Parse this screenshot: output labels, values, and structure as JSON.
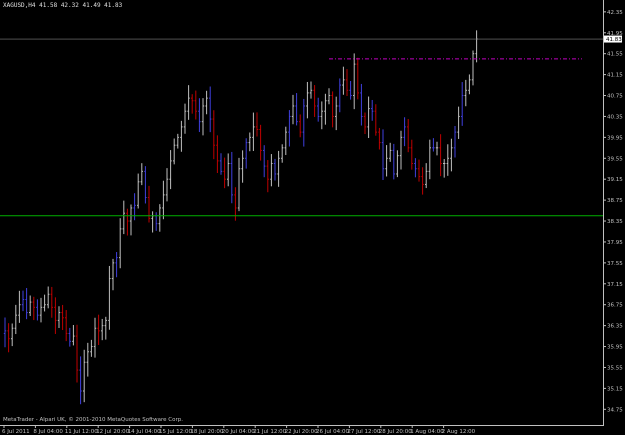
{
  "header": {
    "symbol": "XAGUSD,H4",
    "ohlc": "41.58 42.32 41.49 41.83"
  },
  "copyright": "MetaTrader - Alpari UK, © 2001-2010 MetaQuotes Software Corp.",
  "current_price_label": "41.83",
  "colors": {
    "background": "#000000",
    "up_bar": "#c0c0c0",
    "down_bar_red": "#c00000",
    "down_bar_blue": "#4040e0",
    "green_level": "#00b000",
    "magenta_level": "#c000c0",
    "axis_text": "#c0c0c0"
  },
  "chart_data": {
    "type": "ohlc",
    "title": "XAGUSD,H4",
    "ylim": [
      34.45,
      42.5
    ],
    "y_ticks": [
      "42.35",
      "41.95",
      "41.55",
      "41.15",
      "40.75",
      "40.35",
      "39.95",
      "39.55",
      "39.15",
      "38.75",
      "38.35",
      "37.95",
      "37.55",
      "37.15",
      "36.75",
      "36.35",
      "35.95",
      "35.55",
      "35.15",
      "34.75"
    ],
    "x_tick_labels": [
      "6 Jul 2011",
      "8 Jul 04:00",
      "11 Jul 12:00",
      "12 Jul 20:00",
      "14 Jul 04:00",
      "15 Jul 12:00",
      "18 Jul 20:00",
      "20 Jul 04:00",
      "21 Jul 12:00",
      "22 Jul 20:00",
      "26 Jul 04:00",
      "27 Jul 12:00",
      "28 Jul 20:00",
      "1 Aug 04:00",
      "2 Aug 12:00"
    ],
    "horizontal_levels": [
      {
        "price": 38.45,
        "style": "solid",
        "color": "#00b000"
      },
      {
        "price": 41.45,
        "style": "dashdot",
        "color": "#c000c0",
        "from_bar": 90
      }
    ],
    "closes": [
      36.25,
      36.1,
      36.3,
      36.55,
      36.75,
      36.85,
      36.6,
      36.8,
      36.7,
      36.55,
      36.7,
      36.75,
      36.95,
      36.7,
      36.45,
      36.6,
      36.5,
      36.2,
      36.05,
      36.15,
      35.5,
      35.1,
      35.65,
      35.85,
      35.95,
      36.3,
      36.25,
      36.35,
      36.45,
      37.25,
      37.55,
      37.65,
      38.2,
      38.5,
      38.35,
      38.6,
      38.65,
      39.1,
      39.3,
      38.8,
      38.4,
      38.45,
      38.3,
      38.6,
      38.85,
      39.15,
      39.5,
      39.8,
      39.95,
      40.15,
      40.45,
      40.7,
      40.65,
      40.45,
      40.25,
      40.55,
      40.7,
      40.3,
      39.8,
      39.5,
      39.3,
      39.15,
      39.45,
      38.85,
      38.6,
      39.35,
      39.55,
      39.85,
      39.95,
      40.15,
      40.1,
      39.7,
      39.4,
      39.15,
      39.45,
      39.25,
      39.55,
      39.75,
      40.05,
      40.35,
      40.55,
      40.25,
      40.05,
      40.55,
      40.8,
      40.85,
      40.55,
      40.35,
      40.45,
      40.65,
      40.75,
      40.35,
      40.55,
      40.95,
      41.05,
      40.85,
      40.75,
      41.35,
      40.8,
      40.35,
      40.15,
      40.5,
      40.45,
      40.05,
      39.85,
      39.35,
      39.55,
      39.7,
      39.25,
      39.6,
      39.95,
      40.15,
      39.75,
      39.45,
      39.35,
      39.2,
      39.05,
      39.3,
      39.75,
      39.75,
      39.75,
      39.45,
      39.45,
      39.55,
      39.75,
      40.05,
      40.35,
      40.75,
      40.85,
      41.05,
      41.55,
      41.83
    ]
  }
}
